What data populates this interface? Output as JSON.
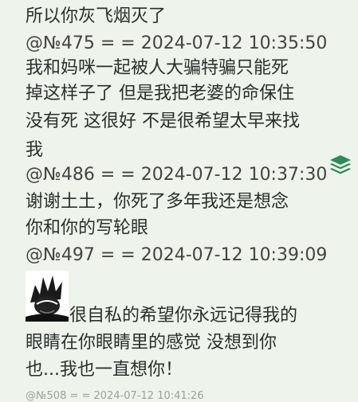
{
  "thread": {
    "lines": [
      "所以你灰飞烟灭了",
      "@№475 = = 2024-07-12 10:35:50",
      "我和妈咪一起被人大骗特骗只能死",
      "掉这样子了 但是我把老婆的命保住",
      "没有死 这很好 不是很希望太早来找",
      "我",
      "@№486 = = 2024-07-12 10:37:30",
      "谢谢土土，你死了多年我还是想念",
      "你和你的写轮眼",
      "@№497 = = 2024-07-12 10:39:09",
      "很自私的希望你永远记得我的",
      "眼睛在你眼睛里的感觉 没想到你",
      "也...我也一直想你！"
    ],
    "cutoff_line": "@№508 = = 2024-07-12 10:41:26"
  },
  "icons": {
    "layers": "layers-icon",
    "avatar": "avatar-image"
  },
  "colors": {
    "background": "#eef3ec",
    "text": "#2b2f2b",
    "accent": "#2e8b57"
  }
}
